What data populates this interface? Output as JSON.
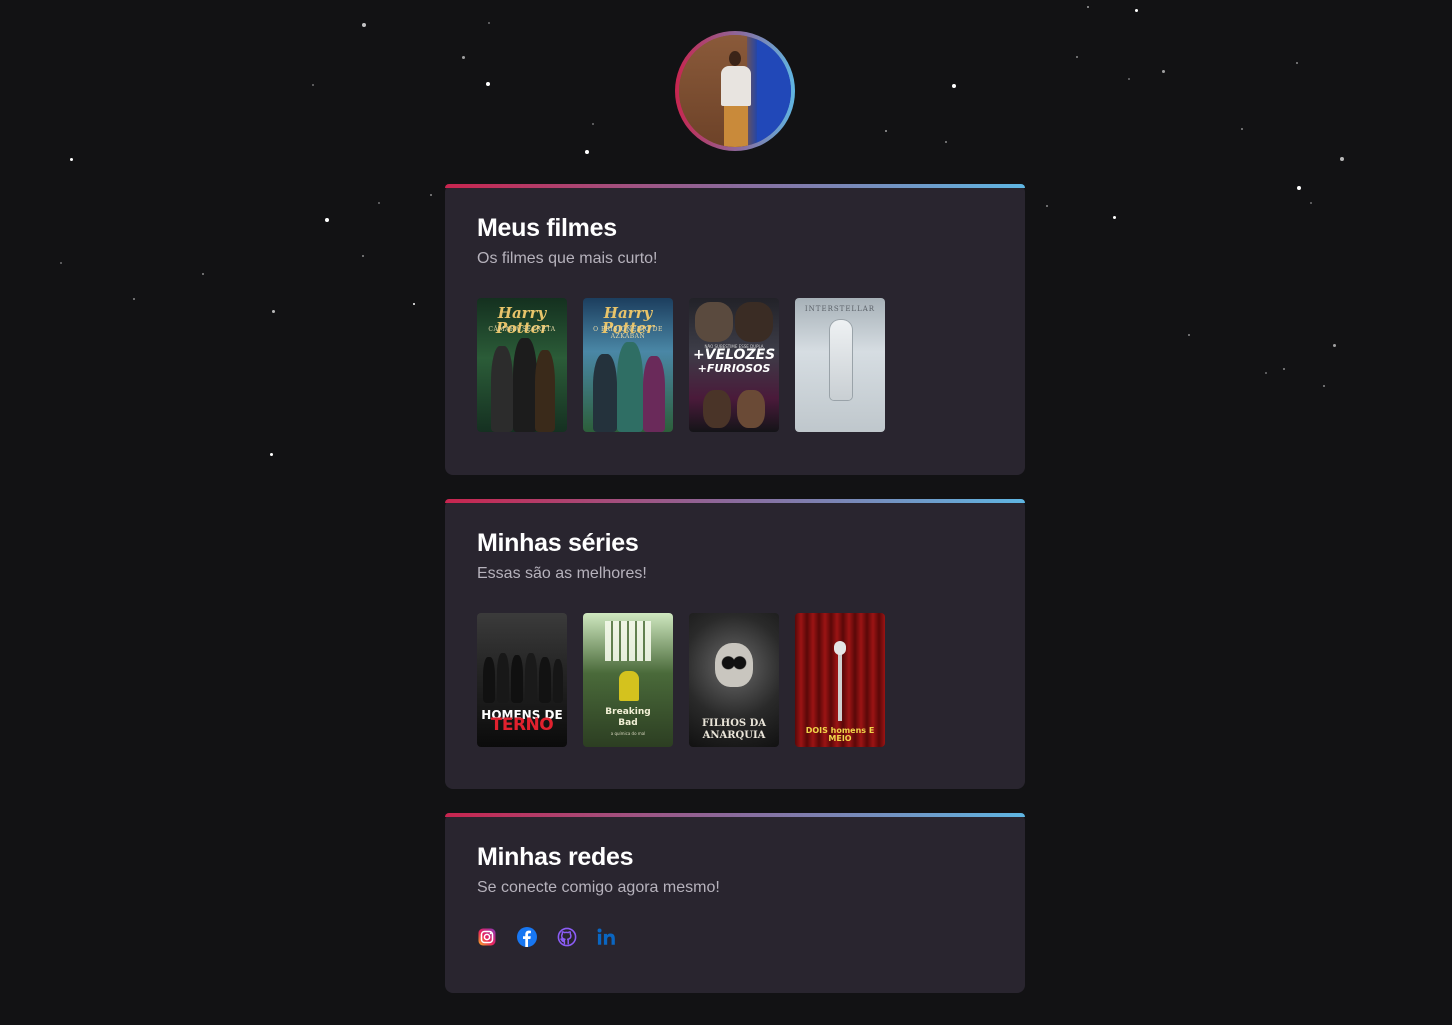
{
  "colors": {
    "background": "#121214",
    "card": "#29252f",
    "gradient_start": "#c8254f",
    "gradient_end": "#5fb6e3",
    "title": "#ffffff",
    "subtitle": "#b6b2bc"
  },
  "profile": {
    "avatar_alt": "avatar"
  },
  "movies": {
    "title": "Meus filmes",
    "subtitle": "Os filmes que mais curto!",
    "items": [
      {
        "poster_title": "Harry Potter",
        "poster_subtitle": "CÂMARA SECRETA"
      },
      {
        "poster_title": "Harry Potter",
        "poster_subtitle": "O PRISIONEIRO DE AZKABAN"
      },
      {
        "poster_tagline": "NÃO SUBESTIME ESSE DUPLA",
        "poster_title": "+VELOZES",
        "poster_title2": "+FURIOSOS"
      },
      {
        "poster_title": "INTERSTELLAR"
      }
    ]
  },
  "series": {
    "title": "Minhas séries",
    "subtitle": "Essas são as melhores!",
    "items": [
      {
        "poster_title": "HOMENS DE",
        "poster_title2": "TERNO"
      },
      {
        "poster_title": "Breaking",
        "poster_title2": "Bad",
        "poster_tagline": "a química do mal"
      },
      {
        "poster_title": "FILHOS DA",
        "poster_title2": "ANARQUIA"
      },
      {
        "poster_title": "DOIS homens E MEIO"
      }
    ]
  },
  "socials": {
    "title": "Minhas redes",
    "subtitle": "Se conecte comigo agora mesmo!",
    "items": [
      {
        "icon": "instagram-icon"
      },
      {
        "icon": "facebook-icon"
      },
      {
        "icon": "github-icon"
      },
      {
        "icon": "linkedin-icon"
      }
    ]
  }
}
